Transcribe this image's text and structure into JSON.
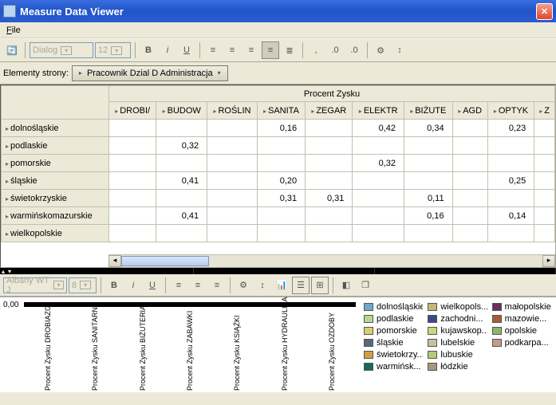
{
  "window": {
    "title": "Measure Data Viewer"
  },
  "menu": {
    "file": "File"
  },
  "toolbar1": {
    "font_combo": "Dialog",
    "size_combo": "12"
  },
  "elements": {
    "label": "Elementy strony:",
    "pill": "Pracownik Dzial D  Administracja"
  },
  "grid": {
    "super_header": "Procent Zysku",
    "columns": [
      "DROBI/",
      "BUDOW",
      "ROŚLIN",
      "SANITA",
      "ZEGAR",
      "ELEKTR",
      "BIŻUTE",
      "AGD",
      "OPTYK",
      "Z"
    ],
    "rows": [
      {
        "label": "dolnośląskie",
        "cells": [
          "",
          "",
          "",
          "0,16",
          "",
          "0,42",
          "0,34",
          "",
          "0,23",
          ""
        ]
      },
      {
        "label": "podlaskie",
        "cells": [
          "",
          "0,32",
          "",
          "",
          "",
          "",
          "",
          "",
          "",
          ""
        ]
      },
      {
        "label": "pomorskie",
        "cells": [
          "",
          "",
          "",
          "",
          "",
          "0,32",
          "",
          "",
          "",
          ""
        ]
      },
      {
        "label": "śląskie",
        "cells": [
          "",
          "0,41",
          "",
          "0,20",
          "",
          "",
          "",
          "",
          "0,25",
          ""
        ]
      },
      {
        "label": "świetokrzyskie",
        "cells": [
          "",
          "",
          "",
          "0,31",
          "0,31",
          "",
          "0,11",
          "",
          "",
          ""
        ]
      },
      {
        "label": "warmińskomazurskie",
        "cells": [
          "",
          "0,41",
          "",
          "",
          "",
          "",
          "0,16",
          "",
          "0,14",
          ""
        ]
      },
      {
        "label": "wielkopolskie",
        "cells": [
          "",
          "",
          "",
          "",
          "",
          "",
          "",
          "",
          "",
          ""
        ]
      }
    ]
  },
  "toolbar2": {
    "font_combo": "Albany WT J",
    "size_combo": "8"
  },
  "chart": {
    "y_zero": "0,00",
    "xcats": [
      "Procent Zysku\nDROBIAZGI",
      "Procent Zysku\nSANITARNE",
      "Procent Zysku\nBIŻUTERIA",
      "Procent Zysku\nZABAWKI",
      "Procent Zysku\nKSIĄŻKI",
      "Procent Zysku\nHYDRAULIKA",
      "Procent Zysku\nOZDOBY"
    ]
  },
  "legend": [
    {
      "c": "#6fa8c8",
      "l": "dolnośląskie"
    },
    {
      "c": "#c4b878",
      "l": "wielkopols..."
    },
    {
      "c": "#6a2f5a",
      "l": "małopolskie"
    },
    {
      "c": "#b8d890",
      "l": "podlaskie"
    },
    {
      "c": "#3a4a8a",
      "l": "zachodni..."
    },
    {
      "c": "#a85a3a",
      "l": "mazowie..."
    },
    {
      "c": "#d8d068",
      "l": "pomorskie"
    },
    {
      "c": "#c8d878",
      "l": "kujawskop..."
    },
    {
      "c": "#8ab868",
      "l": "opolskie"
    },
    {
      "c": "#586878",
      "l": "śląskie"
    },
    {
      "c": "#c8c0a0",
      "l": "lubelskie"
    },
    {
      "c": "#c89888",
      "l": "podkarpa..."
    },
    {
      "c": "#d0a040",
      "l": "świetokrzy..."
    },
    {
      "c": "#b8c878",
      "l": "lubuskie"
    },
    {
      "c": "",
      "l": ""
    },
    {
      "c": "#186858",
      "l": "warmińsk..."
    },
    {
      "c": "#a89878",
      "l": "łódzkie"
    },
    {
      "c": "",
      "l": ""
    }
  ]
}
